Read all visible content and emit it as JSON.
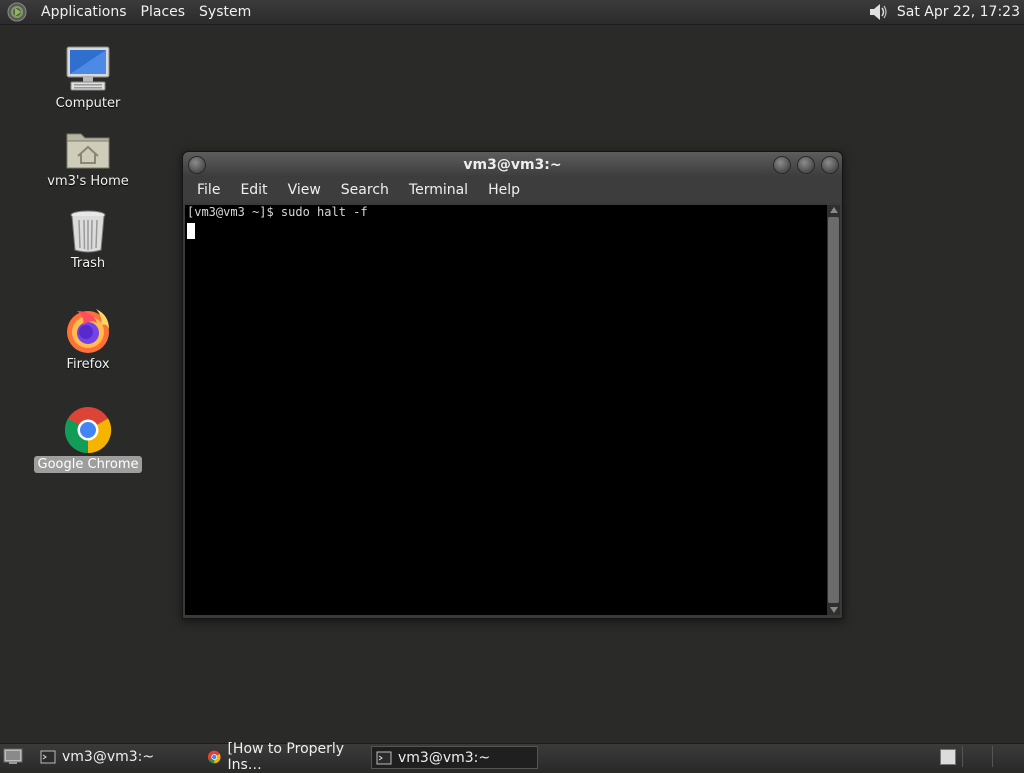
{
  "top_panel": {
    "menus": [
      "Applications",
      "Places",
      "System"
    ],
    "clock": "Sat Apr 22, 17:23"
  },
  "desktop": {
    "icons": [
      {
        "label": "Computer",
        "icon": "computer-icon"
      },
      {
        "label": "vm3's Home",
        "icon": "home-folder-icon"
      },
      {
        "label": "Trash",
        "icon": "trash-icon"
      },
      {
        "label": "Firefox",
        "icon": "firefox-icon"
      },
      {
        "label": "Google Chrome",
        "icon": "chrome-icon",
        "selected": true
      }
    ]
  },
  "terminal": {
    "title": "vm3@vm3:~",
    "menus": [
      "File",
      "Edit",
      "View",
      "Search",
      "Terminal",
      "Help"
    ],
    "lines": [
      "[vm3@vm3 ~]$ sudo halt -f"
    ]
  },
  "taskbar": {
    "tasks": [
      {
        "label": "vm3@vm3:~",
        "icon": "terminal-icon",
        "active": false
      },
      {
        "label": "[How to Properly Ins…",
        "icon": "chrome-icon",
        "active": false
      },
      {
        "label": "vm3@vm3:~",
        "icon": "terminal-icon",
        "active": true
      }
    ]
  }
}
